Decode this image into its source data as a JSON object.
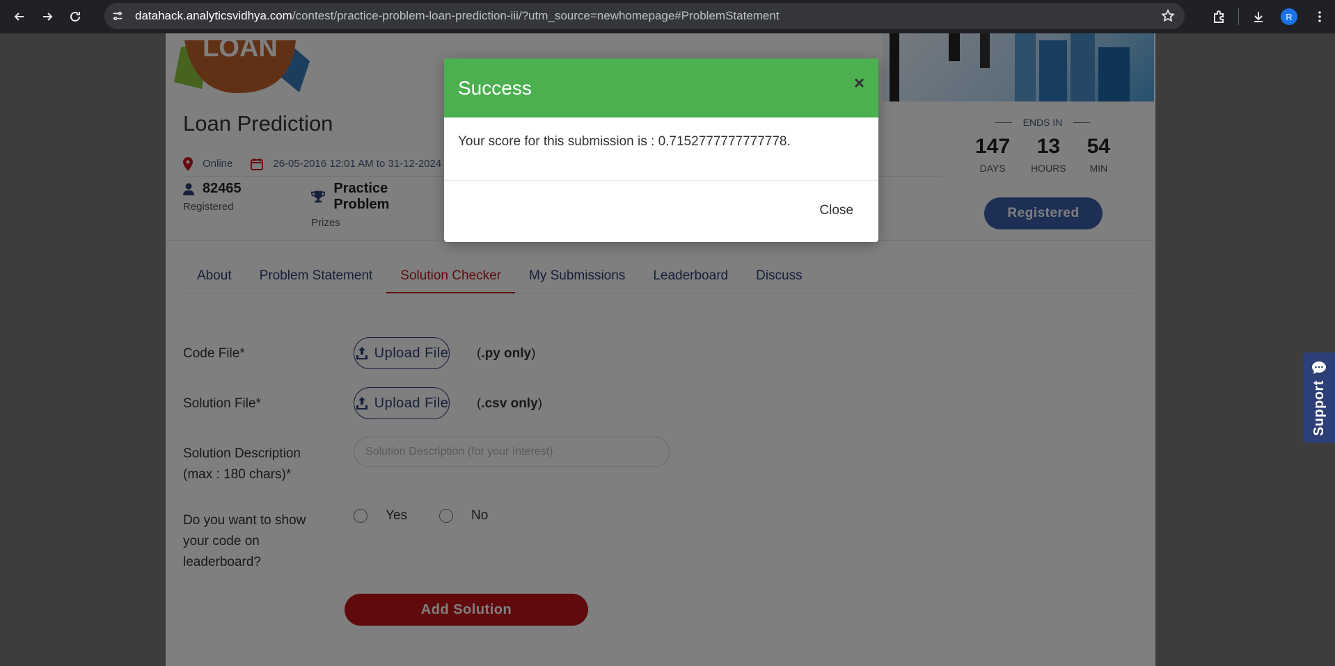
{
  "browser": {
    "url_host": "datahack.analyticsvidhya.com",
    "url_rest": "/contest/practice-problem-loan-prediction-iii/?utm_source=newhomepage#ProblemStatement",
    "profile_initial": "R"
  },
  "banner": {
    "logo_text": "LOAN"
  },
  "contest": {
    "title": "Loan Prediction",
    "location": "Online",
    "dates": "26-05-2016 12:01 AM to 31-12-2024",
    "registered_count": "82465",
    "registered_label": "Registered",
    "prize": "Practice Problem",
    "prize_label": "Prizes"
  },
  "countdown": {
    "label": "ENDS IN",
    "days": "147",
    "days_label": "DAYS",
    "hours": "13",
    "hours_label": "HOURS",
    "min": "54",
    "min_label": "MIN"
  },
  "registered_button": "Registered",
  "tabs": [
    {
      "label": "About"
    },
    {
      "label": "Problem Statement"
    },
    {
      "label": "Solution Checker"
    },
    {
      "label": "My Submissions"
    },
    {
      "label": "Leaderboard"
    },
    {
      "label": "Discuss"
    }
  ],
  "active_tab": "Solution Checker",
  "form": {
    "code_file_label": "Code File*",
    "solution_file_label": "Solution File*",
    "upload_label": "Upload File",
    "code_hint_open": "(",
    "code_hint_bold": ".py only",
    "code_hint_close": ")",
    "csv_hint_open": "(",
    "csv_hint_bold": ".csv only",
    "csv_hint_close": ")",
    "description_label_1": "Solution Description",
    "description_label_2": "(max : 180 chars)*",
    "description_placeholder": "Solution Description (for your Interest)",
    "show_code_label_1": "Do you want to show",
    "show_code_label_2": "your code on",
    "show_code_label_3": "leaderboard?",
    "yes": "Yes",
    "no": "No",
    "submit": "Add Solution"
  },
  "support": "Support",
  "modal": {
    "title": "Success",
    "close_x": "×",
    "message": "Your score for this submission is : 0.7152777777777778.",
    "close_button": "Close"
  },
  "colors": {
    "success_header": "#4caf50",
    "brand_red": "#c0141a",
    "brand_blue": "#2d3f77"
  }
}
